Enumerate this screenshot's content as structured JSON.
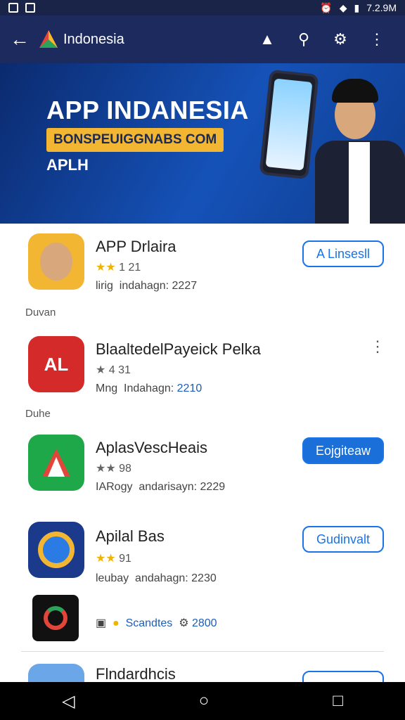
{
  "status": {
    "time": "7.2.9M"
  },
  "appbar": {
    "title": "Indonesia",
    "back": "←"
  },
  "banner": {
    "headline": "APP INDANESIA",
    "tagline": "BONSPEUIGGNABS COM",
    "sub": "APLH"
  },
  "apps": [
    {
      "name": "APP Drlaira",
      "stars": "★★",
      "rating": "1 21",
      "meta_prefix": "lirig",
      "meta_text": "indahagn:",
      "meta_num": "2227",
      "button": "A Linsesll",
      "button_style": "outline",
      "icon_color": "#f2b632"
    },
    {
      "name": "BlaaltedelPayeick Pelka",
      "stars": "★",
      "rating": "4 31",
      "meta_prefix": "Mng",
      "meta_text": "Indahagn:",
      "meta_num": "2210",
      "button": "",
      "button_style": "menu",
      "icon_color": "#d42a2a"
    },
    {
      "name": "AplasVescHeais",
      "stars": "★★",
      "rating": "98",
      "meta_prefix": "IARogy",
      "meta_text": "andarisayn:",
      "meta_num": "2229",
      "button": "Eojgiteaw",
      "button_style": "filled",
      "icon_color": "#1fa84a"
    },
    {
      "name": "Apilal Bas",
      "stars": "★★",
      "rating": "91",
      "meta_prefix": "leubay",
      "meta_text": "andahagn:",
      "meta_num": "2230",
      "button": "Gudinvalt",
      "button_style": "outline",
      "icon_color": "#1b3a8c"
    },
    {
      "name": "",
      "stars": "",
      "rating": "",
      "meta_prefix": "Scandtes",
      "meta_text": "",
      "meta_num": "2800",
      "button": "",
      "button_style": "none",
      "icon_color": "#111"
    },
    {
      "name": "Flndardhcis",
      "stars": "",
      "rating": "",
      "meta_prefix": "",
      "meta_text": "",
      "meta_num": "",
      "button": "",
      "button_style": "outline",
      "icon_color": "#6aa6e8"
    }
  ],
  "sections": [
    "Duvan",
    "Duhe"
  ],
  "nav": {
    "back": "◁",
    "home": "○",
    "recent": "□"
  }
}
